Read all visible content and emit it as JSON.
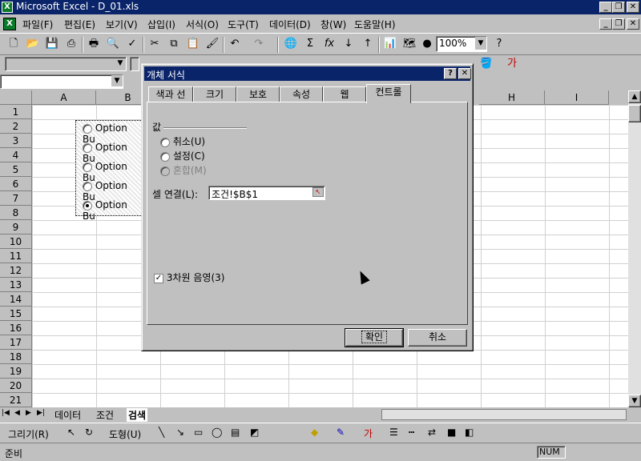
{
  "window": {
    "title": "Microsoft Excel - D_01.xls"
  },
  "menu": [
    "파일(F)",
    "편집(E)",
    "보기(V)",
    "삽입(I)",
    "서식(O)",
    "도구(T)",
    "데이터(D)",
    "창(W)",
    "도움말(H)"
  ],
  "toolbar": {
    "zoom": "100%"
  },
  "namebox": "",
  "columns": [
    "A",
    "B",
    "H",
    "I"
  ],
  "rows": [
    "1",
    "2",
    "3",
    "4",
    "5",
    "6",
    "7",
    "8",
    "9",
    "10",
    "11",
    "12",
    "13",
    "14",
    "15",
    "16",
    "17",
    "18",
    "19",
    "20",
    "21"
  ],
  "options": [
    "Option Bu",
    "Option Bu",
    "Option Bu",
    "Option Bu",
    "Option Bu"
  ],
  "dialog": {
    "title": "개체 서식",
    "help": "?",
    "close": "✕",
    "tabs": [
      "색과 선",
      "크기",
      "보호",
      "속성",
      "웹",
      "컨트롤"
    ],
    "group_label": "값",
    "radio_unchecked": "취소(U)",
    "radio_checked": "설정(C)",
    "radio_mixed": "혼합(M)",
    "link_label": "셀 연결(L):",
    "link_value": "조건!$B$1",
    "shading_label": "3차원 음영(3)",
    "ok": "확인",
    "cancel": "취소"
  },
  "sheets": [
    "데이터",
    "조건",
    "검색"
  ],
  "drawing": {
    "draw_label": "그리기(R)",
    "autoshape_label": "도형(U)"
  },
  "status": {
    "ready": "준비",
    "num": "NUM"
  }
}
